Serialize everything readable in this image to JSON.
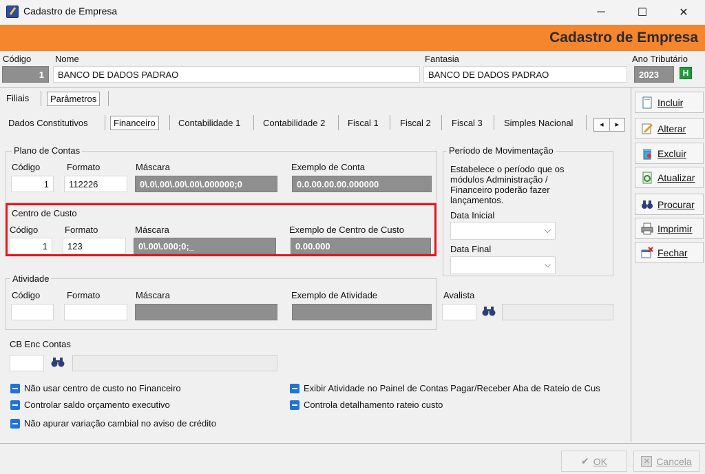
{
  "window": {
    "title": "Cadastro de Empresa",
    "banner_title": "Cadastro de Empresa",
    "minimize": "─",
    "maximize": "☐",
    "close": "✕"
  },
  "header": {
    "codigo_label": "Código",
    "codigo_value": "1",
    "nome_label": "Nome",
    "nome_value": "BANCO DE DADOS PADRAO",
    "fantasia_label": "Fantasia",
    "fantasia_value": "BANCO DE DADOS PADRAO",
    "ano_label": "Ano Tributário",
    "ano_value": "2023",
    "ano_help": "H"
  },
  "main_tabs": [
    "Filiais",
    "Parâmetros"
  ],
  "sub_tabs": [
    "Dados  Constitutivos",
    "Financeiro",
    "Contabilidade 1",
    "Contabilidade 2",
    "Fiscal 1",
    "Fiscal 2",
    "Fiscal 3",
    "Simples Nacional"
  ],
  "scroll_left": "◂",
  "scroll_right": "▸",
  "plano": {
    "title": "Plano de Contas",
    "codigo_label": "Código",
    "formato_label": "Formato",
    "mascara_label": "Máscara",
    "exemplo_label": "Exemplo de Conta",
    "codigo_value": "1",
    "formato_value": "112226",
    "mascara_value": "0\\.0\\.00\\.00\\.00\\.000000;0",
    "exemplo_value": "0.0.00.00.00.000000"
  },
  "centro": {
    "title": "Centro de Custo",
    "codigo_label": "Código",
    "formato_label": "Formato",
    "mascara_label": "Máscara",
    "exemplo_label": "Exemplo de Centro de Custo",
    "codigo_value": "1",
    "formato_value": "123",
    "mascara_value": "0\\.00\\.000;0;_",
    "exemplo_value": "0.00.000"
  },
  "atividade": {
    "title": "Atividade",
    "codigo_label": "Código",
    "formato_label": "Formato",
    "mascara_label": "Máscara",
    "exemplo_label": "Exemplo de Atividade"
  },
  "periodo": {
    "title": "Período de Movimentação",
    "description": "Estabelece o período que os módulos Administração / Financeiro poderão fazer lançamentos.",
    "data_inicial_label": "Data Inicial",
    "data_final_label": "Data Final",
    "dropdown_arrow": "⌵"
  },
  "avalista_label": "Avalista",
  "cb_enc_label": "CB Enc Contas",
  "checkboxes": [
    "Não usar centro de custo no Financeiro",
    "Controlar saldo orçamento executivo",
    "Não apurar variação cambial no aviso de crédito",
    "Exibir Atividade no Painel de Contas Pagar/Receber Aba de Rateio de Cus",
    "Controla detalhamento rateio custo"
  ],
  "buttons": {
    "incluir": "Incluir",
    "alterar": "Alterar",
    "excluir": "Excluir",
    "atualizar": "Atualizar",
    "procurar": "Procurar",
    "imprimir": "Imprimir",
    "fechar": "Fechar",
    "ok": "OK",
    "cancela": "Cancela"
  },
  "colors": {
    "banner": "#f5862e",
    "highlight": "#e3141b",
    "checkbox": "#1e73d8"
  }
}
